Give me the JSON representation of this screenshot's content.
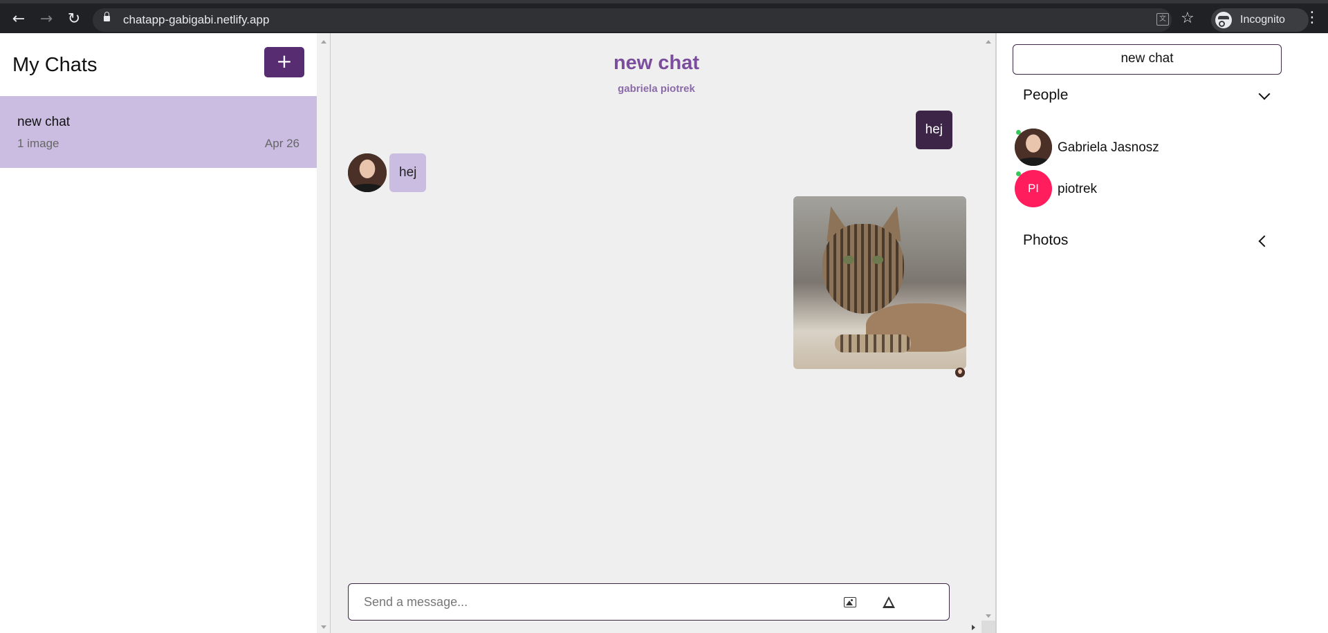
{
  "browser": {
    "url": "chatapp-gabigabi.netlify.app",
    "profile_label": "Incognito",
    "icons": [
      "back-icon",
      "forward-icon",
      "reload-icon",
      "lock-icon",
      "translate-icon",
      "star-icon",
      "incognito-icon",
      "menu-icon"
    ]
  },
  "sidebar": {
    "title": "My Chats",
    "add_label": "+",
    "chats": [
      {
        "title": "new chat",
        "last_message": "1 image",
        "date": "Apr 26"
      }
    ]
  },
  "chat": {
    "title": "new chat",
    "members": "gabriela piotrek",
    "messages": [
      {
        "sender": "me",
        "text": "hej"
      },
      {
        "sender": "them",
        "text": "hej"
      },
      {
        "sender": "me",
        "type": "image",
        "content": "cat-photo"
      }
    ],
    "composer_placeholder": "Send a message..."
  },
  "settings": {
    "chat_name_button": "new chat",
    "people_heading": "People",
    "people": [
      {
        "name": "Gabriela Jasnosz",
        "online": true
      },
      {
        "name": "piotrek",
        "initials": "PI",
        "online": true
      }
    ],
    "photos_heading": "Photos"
  },
  "colors": {
    "accent_purple": "#572c70",
    "my_bubble": "#3d2548",
    "their_bubble": "#cabde1",
    "selected_chat": "#cabde1",
    "title_purple": "#7a4e9c",
    "pi_avatar": "#ff1d5e",
    "online": "#35c759"
  }
}
